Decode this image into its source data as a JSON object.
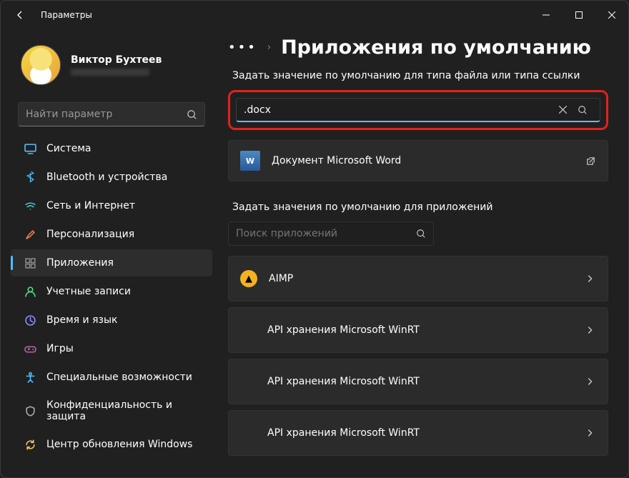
{
  "titlebar": {
    "title": "Параметры"
  },
  "profile": {
    "name": "Виктор Бухтеев"
  },
  "sidebar_search": {
    "placeholder": "Найти параметр"
  },
  "nav": [
    {
      "label": "Система",
      "icon": "monitor",
      "color": "#4cc2ff"
    },
    {
      "label": "Bluetooth и устройства",
      "icon": "bluetooth",
      "color": "#4cc2ff"
    },
    {
      "label": "Сеть и Интернет",
      "icon": "wifi",
      "color": "#3dcad0"
    },
    {
      "label": "Персонализация",
      "icon": "brush",
      "color": "#e87b4e"
    },
    {
      "label": "Приложения",
      "icon": "apps",
      "color": "#888888",
      "active": true
    },
    {
      "label": "Учетные записи",
      "icon": "person",
      "color": "#4fe08a"
    },
    {
      "label": "Время и язык",
      "icon": "clock",
      "color": "#8f8fff"
    },
    {
      "label": "Игры",
      "icon": "gamepad",
      "color": "#b85fa3"
    },
    {
      "label": "Специальные возможности",
      "icon": "accessibility",
      "color": "#4cc2ff"
    },
    {
      "label": "Конфиденциальность и защита",
      "icon": "shield",
      "color": "#aaaaaa"
    },
    {
      "label": "Центр обновления Windows",
      "icon": "sync",
      "color": "#f0c65a"
    }
  ],
  "breadcrumb": {
    "title": "Приложения по умолчанию"
  },
  "filetype_section_label": "Задать значение по умолчанию для типа файла или типа ссылки",
  "filetype_search": {
    "value": ".docx"
  },
  "filetype_result": {
    "label": "Документ Microsoft Word"
  },
  "apps_section_label": "Задать значения по умолчанию для приложений",
  "apps_search": {
    "placeholder": "Поиск приложений"
  },
  "apps": [
    {
      "label": "AIMP",
      "icon_bg": "#f5b21e",
      "icon_text": "▲",
      "has_icon": true
    },
    {
      "label": "API хранения Microsoft WinRT",
      "has_icon": false
    },
    {
      "label": "API хранения Microsoft WinRT",
      "has_icon": false
    },
    {
      "label": "API хранения Microsoft WinRT",
      "has_icon": false
    }
  ]
}
